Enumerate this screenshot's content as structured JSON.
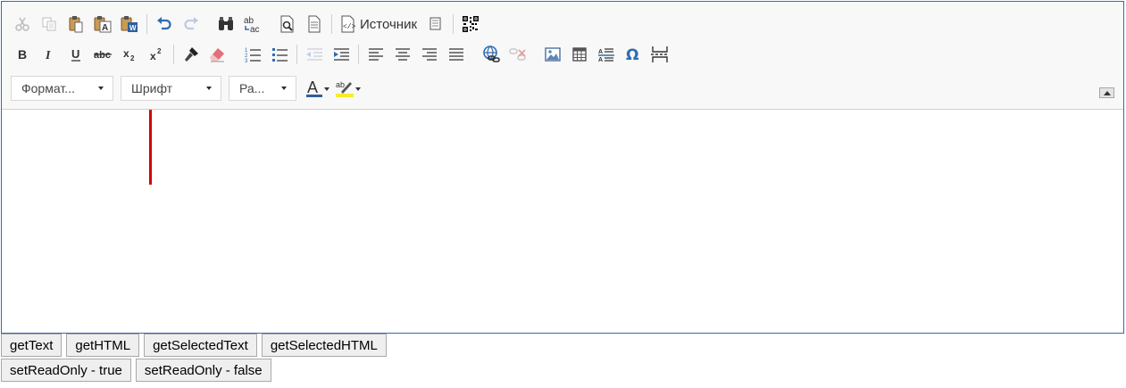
{
  "toolbar": {
    "source_label": "Источник",
    "format_label": "Формат...",
    "font_label": "Шрифт",
    "size_label": "Ра...",
    "icons_row1": [
      "cut-icon",
      "copy-icon",
      "paste-icon",
      "paste-text-icon",
      "paste-word-icon",
      "undo-icon",
      "redo-icon",
      "find-icon",
      "replace-icon",
      "preview-icon",
      "templates-icon",
      "source-icon",
      "maximize-icon",
      "qr-code-icon"
    ],
    "icons_row2": [
      "bold-icon",
      "italic-icon",
      "underline-icon",
      "strikethrough-icon",
      "subscript-icon",
      "superscript-icon",
      "copy-format-icon",
      "remove-format-icon",
      "numbered-list-icon",
      "bulleted-list-icon",
      "outdent-icon",
      "indent-icon",
      "align-left-icon",
      "align-center-icon",
      "align-right-icon",
      "justify-icon",
      "link-icon",
      "unlink-icon",
      "image-icon",
      "table-icon",
      "horizontal-line-icon",
      "special-char-icon",
      "page-break-icon"
    ],
    "icons_row3": [
      "text-color-icon",
      "background-color-icon",
      "collapse-toolbar-icon"
    ]
  },
  "colors": {
    "editor_border": "#2f6bb3",
    "cursor": "#d40000",
    "icon_blue": "#2f6bb3",
    "highlight_yellow": "#f5ec2b"
  },
  "buttons": {
    "row1": [
      "getText",
      "getHTML",
      "getSelectedText",
      "getSelectedHTML"
    ],
    "row2": [
      "setReadOnly - true",
      "setReadOnly - false"
    ]
  }
}
